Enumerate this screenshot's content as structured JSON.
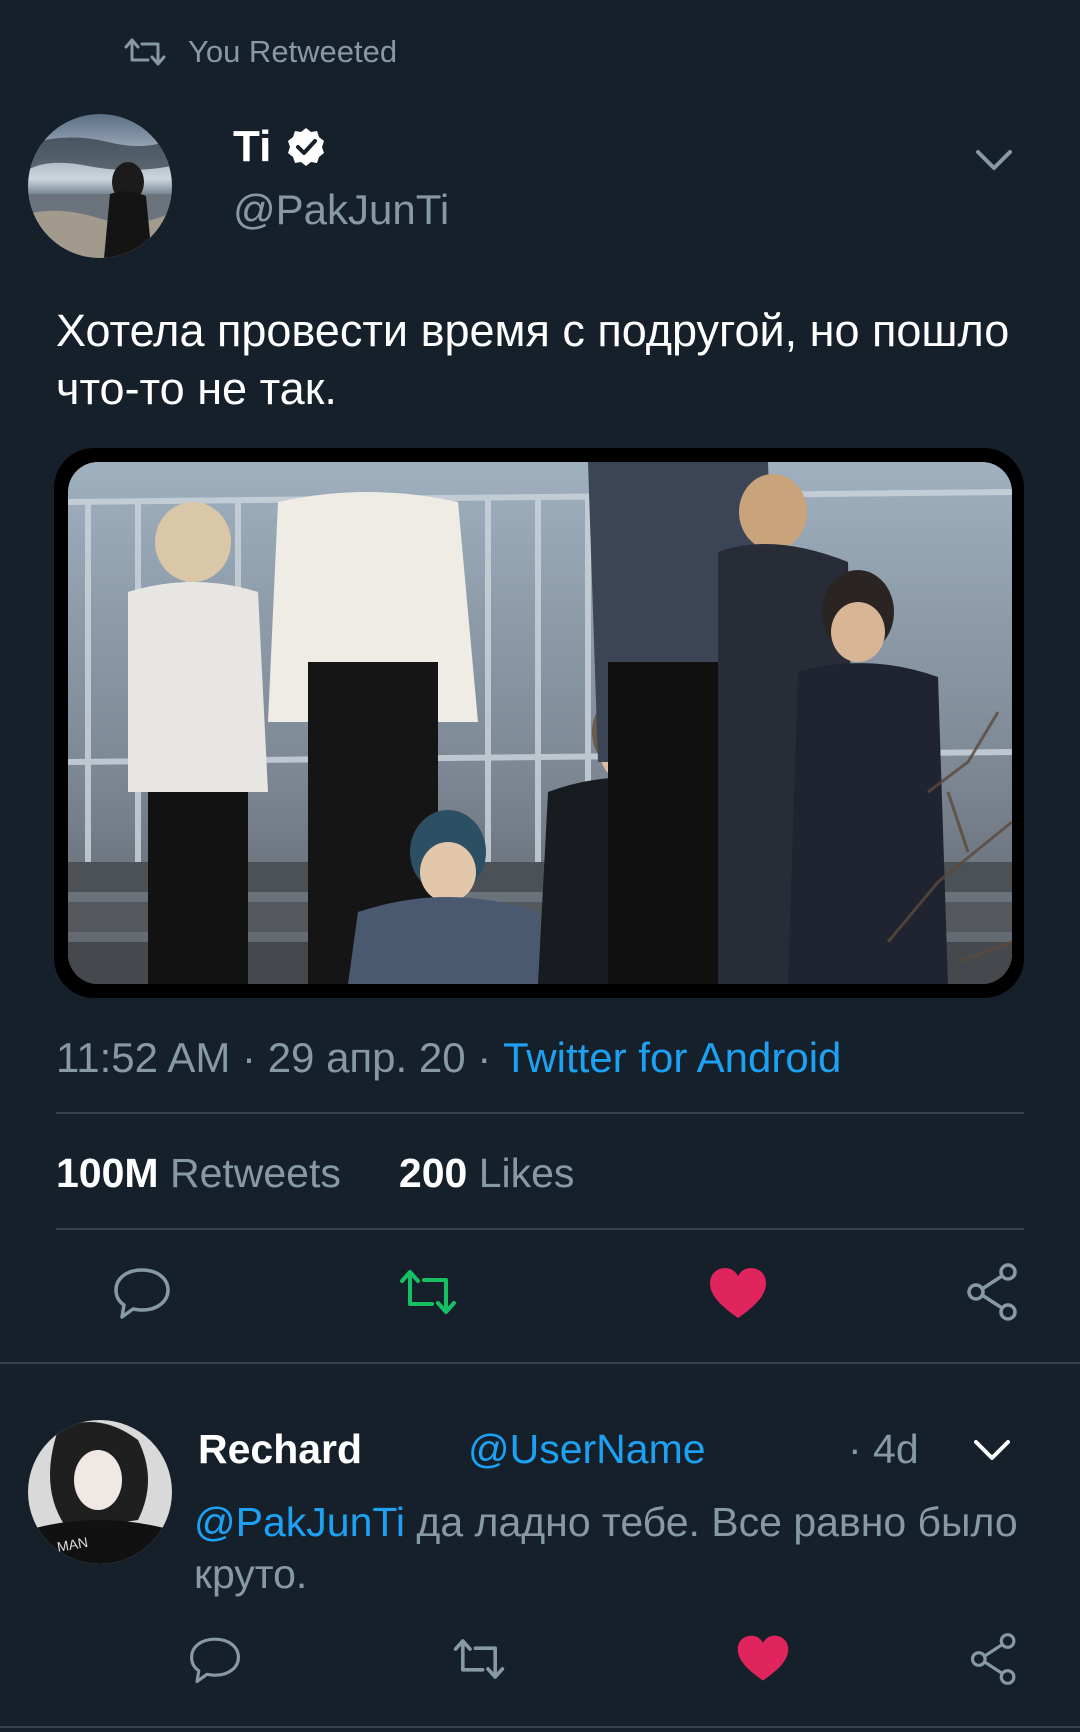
{
  "retweet_header": {
    "label": "You Retweeted"
  },
  "tweet": {
    "author_name": "Ti",
    "handle": "@PakJunTi",
    "text": "Хотела провести время с подругой, но пошло что-то не так.",
    "time": "11:52 AM",
    "sep1": "·",
    "date": "29 апр. 20",
    "sep2": "·",
    "source": "Twitter for Android",
    "retweets_count": "100M",
    "retweets_label": "Retweets",
    "likes_count": "200",
    "likes_label": "Likes"
  },
  "reply": {
    "author_name": "Rechard",
    "handle": "@UserName",
    "time": "· 4d",
    "mention": "@PakJunTi",
    "text": " да ладно тебе. Все равно было круто."
  },
  "icons": {
    "retweet_header": "retweet-icon",
    "verified": "verified-badge-icon",
    "caret": "chevron-down-icon",
    "reply": "reply-icon",
    "retweet": "retweet-icon",
    "like": "heart-icon",
    "share": "share-icon"
  },
  "colors": {
    "background": "#15202b",
    "accent": "#1da1f2",
    "retweet_active": "#17bf63",
    "like_active": "#e0245e",
    "muted": "#8899a6"
  }
}
